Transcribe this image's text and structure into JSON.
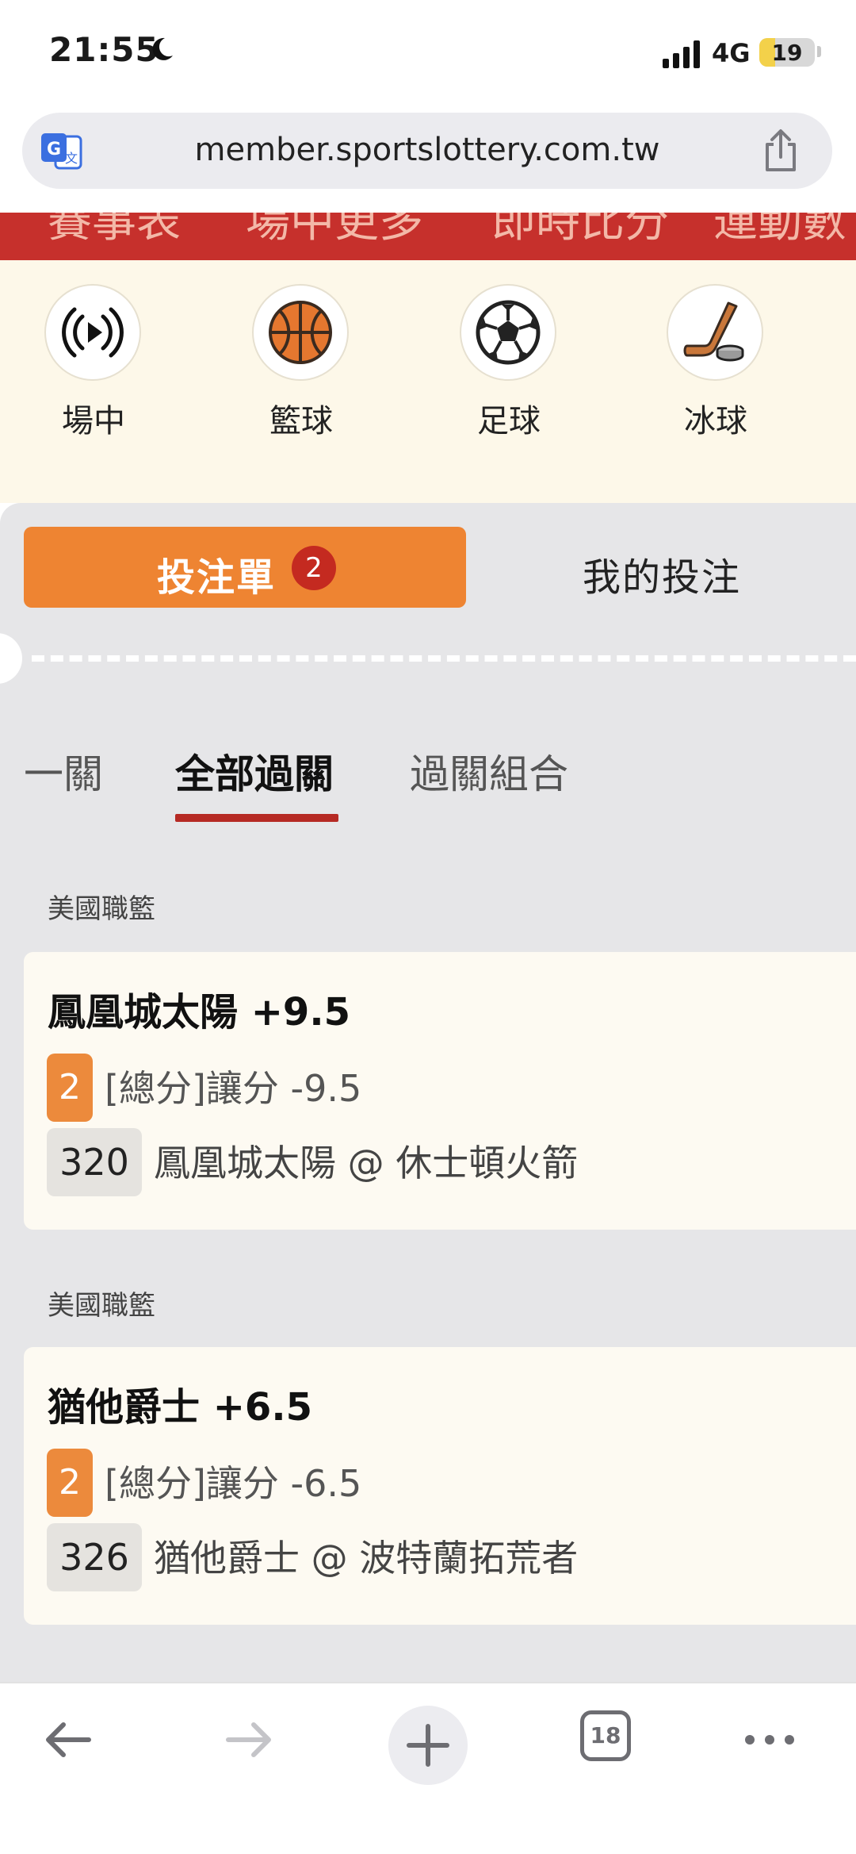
{
  "status_bar": {
    "time": "21:55",
    "network": "4G",
    "battery": "19"
  },
  "browser": {
    "url": "member.sportslottery.com.tw",
    "tab_count": "18"
  },
  "banner": {
    "items": [
      "賽事表",
      "場中更多",
      "即時比分",
      "運動數"
    ]
  },
  "sports": [
    {
      "label": "場中",
      "icon": "live-icon"
    },
    {
      "label": "籃球",
      "icon": "basketball-icon"
    },
    {
      "label": "足球",
      "icon": "soccer-icon"
    },
    {
      "label": "冰球",
      "icon": "ice-hockey-icon"
    }
  ],
  "bet_tabs": {
    "betslip_label": "投注單",
    "betslip_count": "2",
    "my_bets_label": "我的投注"
  },
  "sub_tabs": [
    {
      "label": "一關",
      "active": false
    },
    {
      "label": "全部過關",
      "active": true
    },
    {
      "label": "過關組合",
      "active": false
    }
  ],
  "bets": [
    {
      "league": "美國職籃",
      "selection": "鳳凰城太陽 +9.5",
      "count": "2",
      "market": "[總分]讓分 -9.5",
      "code": "320",
      "match": "鳳凰城太陽 @ 休士頓火箭"
    },
    {
      "league": "美國職籃",
      "selection": "猶他爵士 +6.5",
      "count": "2",
      "market": "[總分]讓分 -6.5",
      "code": "326",
      "match": "猶他爵士 @ 波特蘭拓荒者"
    }
  ],
  "colors": {
    "accent_orange": "#ee8432",
    "brand_red": "#c6302c",
    "badge_red": "#c42a20"
  }
}
